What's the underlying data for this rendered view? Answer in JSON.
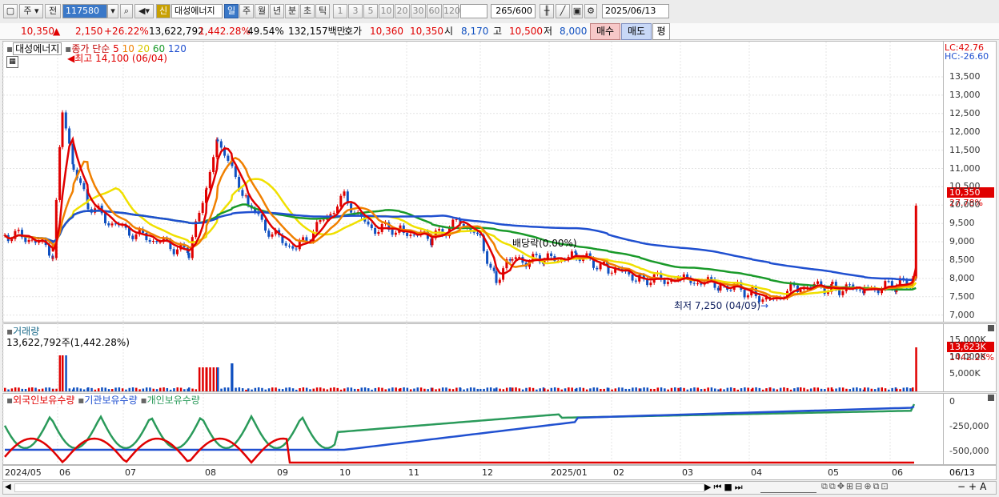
{
  "toolbar": {
    "market": "주",
    "period_type": "전",
    "code": "117580",
    "stock_name": "대성에너지",
    "badge_new": "신",
    "periods": [
      "일",
      "주",
      "월",
      "년",
      "분",
      "초",
      "틱"
    ],
    "period_selected": "일",
    "intervals": [
      "1",
      "3",
      "5",
      "10",
      "20",
      "30",
      "60",
      "120"
    ],
    "count": "265",
    "count_max": "/600",
    "date": "2025/06/13"
  },
  "quote": {
    "price": "10,350",
    "direction": "▲",
    "change": "2,150",
    "change_pct": "+26.22%",
    "volume": "13,622,792",
    "volume_pct": "1,442.28%",
    "ratio": "49.54%",
    "amount": "132,157백만",
    "bid_ask_label": "호가",
    "ask": "10,360",
    "bid": "10,350",
    "open_label": "시",
    "open": "8,170",
    "high_label": "고",
    "high": "10,500",
    "low_label": "저",
    "low": "8,000",
    "buy_label": "매수",
    "sell_label": "매도",
    "avg_label": "평"
  },
  "price_panel": {
    "legend_name": "대성에너지",
    "legend_ma_label": "종가 단순",
    "ma_periods": [
      "5",
      "10",
      "20",
      "60",
      "120"
    ],
    "high_annotation": "최고 14,100 (06/04)",
    "low_annotation": "최저 7,250 (04/09)",
    "dividend_annotation": "배당락(0.00%)",
    "lc": "LC:42.76",
    "hc": "HC:-26.60",
    "current_price": "10,350",
    "current_pct": "27.78%",
    "y_ticks": [
      "13,500",
      "13,000",
      "12,500",
      "12,000",
      "11,500",
      "11,000",
      "10,500",
      "10,000",
      "9,500",
      "9,000",
      "8,500",
      "8,000",
      "7,500",
      "7,000"
    ]
  },
  "volume_panel": {
    "title": "거래량",
    "summary": "13,622,792주(1,442.28%)",
    "current": "13,623K",
    "current_pct": "1442.28%",
    "y_ticks": [
      "15,000K",
      "10,000K",
      "5,000K"
    ]
  },
  "holding_panel": {
    "legend": [
      "외국인보유수량",
      "기관보유수량",
      "개인보유수량"
    ],
    "y_ticks": [
      "0",
      "-250,000",
      "-500,000"
    ]
  },
  "x_axis": {
    "labels": [
      "2024/05",
      "06",
      "07",
      "08",
      "09",
      "10",
      "11",
      "12",
      "2025/01",
      "02",
      "03",
      "04",
      "05",
      "06"
    ],
    "last_date": "06/13"
  },
  "colors": {
    "up": "#e00000",
    "down": "#1050c0",
    "ma5": "#e00000",
    "ma10": "#f08000",
    "ma20": "#f0e000",
    "ma60": "#1a9a2a",
    "ma120": "#2050d0",
    "foreign": "#e00000",
    "institution": "#2050d0",
    "individual": "#2a9a5a"
  }
}
